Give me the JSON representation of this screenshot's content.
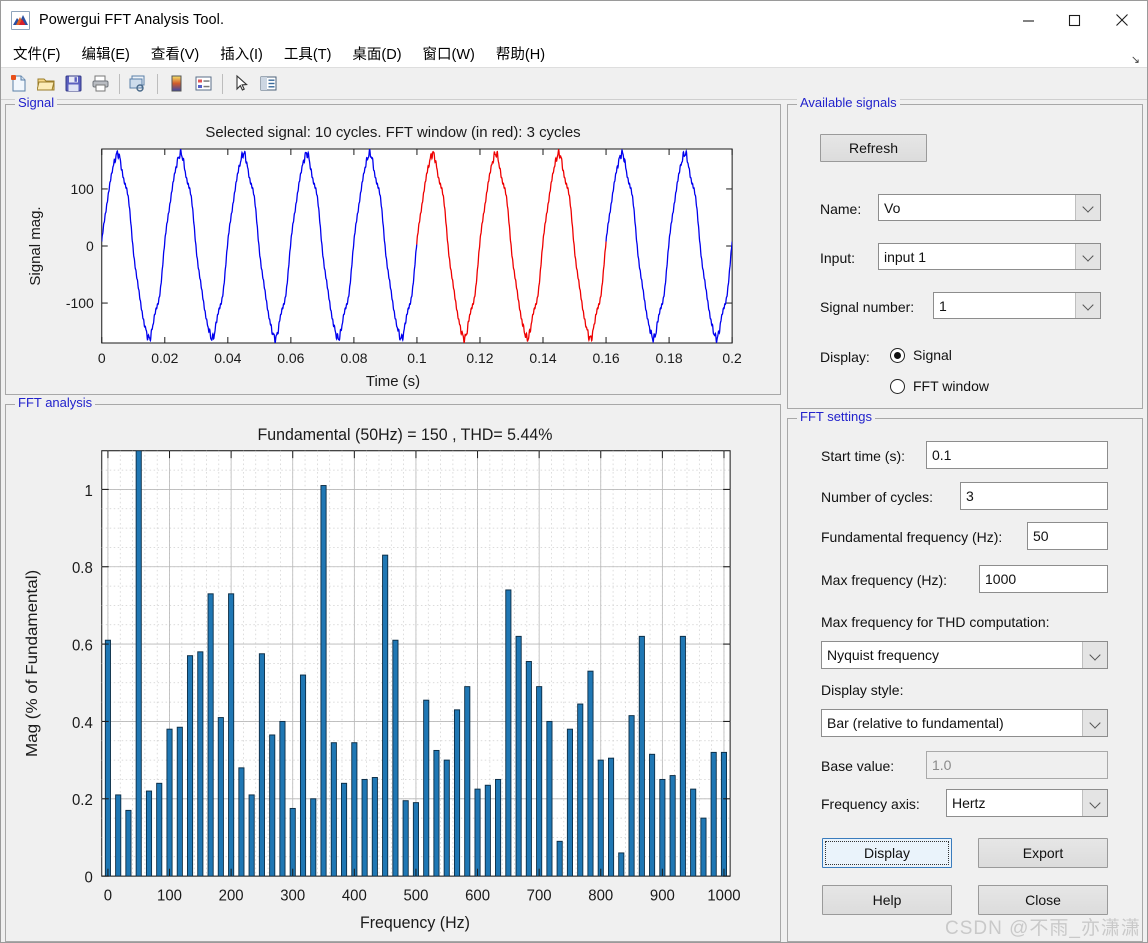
{
  "window": {
    "title": "Powergui FFT Analysis Tool.",
    "icon": "matlab-scope-icon",
    "minimize": "–",
    "maximize": "□",
    "close": "✕"
  },
  "menubar": {
    "items": [
      {
        "name": "file",
        "text": "文件(F)",
        "pre": "文件(",
        "key": "F",
        "post": ")"
      },
      {
        "name": "edit",
        "text": "编辑(E)",
        "pre": "编辑(",
        "key": "E",
        "post": ")"
      },
      {
        "name": "view",
        "text": "查看(V)",
        "pre": "查看(",
        "key": "V",
        "post": ")"
      },
      {
        "name": "insert",
        "text": "插入(I)",
        "pre": "插入(",
        "key": "I",
        "post": ")"
      },
      {
        "name": "tools",
        "text": "工具(T)",
        "pre": "工具(",
        "key": "T",
        "post": ")"
      },
      {
        "name": "desktop",
        "text": "桌面(D)",
        "pre": "桌面(",
        "key": "D",
        "post": ")"
      },
      {
        "name": "window",
        "text": "窗口(W)",
        "pre": "窗口(",
        "key": "W",
        "post": ")"
      },
      {
        "name": "help",
        "text": "帮助(H)",
        "pre": "帮助(",
        "key": "H",
        "post": ")"
      }
    ],
    "overflow": "↘"
  },
  "toolbar": {
    "buttons": [
      {
        "name": "new-figure-icon"
      },
      {
        "name": "open-file-icon"
      },
      {
        "name": "save-figure-icon"
      },
      {
        "name": "print-figure-icon"
      },
      {
        "name": "link-plot-icon"
      },
      {
        "name": "colorbar-icon"
      },
      {
        "name": "legend-icon"
      },
      {
        "name": "pointer-icon"
      },
      {
        "name": "plot-browser-icon"
      }
    ]
  },
  "signal_panel": {
    "legend": "Signal"
  },
  "fft_panel": {
    "legend": "FFT analysis"
  },
  "available_signals": {
    "legend": "Available signals",
    "refresh_label": "Refresh",
    "name_label": "Name:",
    "name_value": "Vo",
    "input_label": "Input:",
    "input_value": "input 1",
    "signal_number_label": "Signal number:",
    "signal_number_value": "1",
    "display_label": "Display:",
    "display_options": [
      {
        "label": "Signal",
        "selected": true
      },
      {
        "label": "FFT window",
        "selected": false
      }
    ]
  },
  "fft_settings": {
    "legend": "FFT settings",
    "start_time_label": "Start time (s):",
    "start_time_value": "0.1",
    "cycles_label": "Number of cycles:",
    "cycles_value": "3",
    "fundamental_label": "Fundamental frequency (Hz):",
    "fundamental_value": "50",
    "maxfreq_label": "Max frequency (Hz):",
    "maxfreq_value": "1000",
    "thd_label": "Max frequency for THD computation:",
    "thd_value": "Nyquist frequency",
    "display_style_label": "Display style:",
    "display_style_value": "Bar (relative to fundamental)",
    "base_value_label": "Base value:",
    "base_value_value": "1.0",
    "freq_axis_label": "Frequency axis:",
    "freq_axis_value": "Hertz",
    "display_button": "Display",
    "export_button": "Export",
    "help_button": "Help",
    "close_button": "Close"
  },
  "watermark": "CSDN @不雨_亦潇潇",
  "chart_data": [
    {
      "id": "signal-plot",
      "type": "line",
      "title": "Selected signal: 10 cycles. FFT window (in red): 3 cycles",
      "xlabel": "Time (s)",
      "ylabel": "Signal mag.",
      "xlim": [
        0,
        0.2
      ],
      "ylim": [
        -170,
        170
      ],
      "xticks": [
        0,
        0.02,
        0.04,
        0.06,
        0.08,
        0.1,
        0.12,
        0.14,
        0.16,
        0.18,
        0.2
      ],
      "xticklabels": [
        "0",
        "0.02",
        "0.04",
        "0.06",
        "0.08",
        "0.1",
        "0.12",
        "0.14",
        "0.16",
        "0.18",
        "0.2"
      ],
      "yticks": [
        -100,
        0,
        100
      ],
      "yticklabels": [
        "-100",
        "0",
        "100"
      ],
      "grid": false,
      "series": [
        {
          "name": "signal",
          "color": "#0000ee",
          "amplitude": 155,
          "frequency": 50,
          "cycles": 10
        },
        {
          "name": "fft-window",
          "color": "#ee0000",
          "window_start": 0.1,
          "window_end": 0.16,
          "cycles": 3
        }
      ]
    },
    {
      "id": "fft-bar-plot",
      "type": "bar",
      "title": "Fundamental (50Hz) = 150 , THD= 5.44%",
      "xlabel": "Frequency (Hz)",
      "ylabel": "Mag (% of Fundamental)",
      "xlim": [
        -10,
        1010
      ],
      "ylim": [
        0,
        1.1
      ],
      "xticks": [
        0,
        100,
        200,
        300,
        400,
        500,
        600,
        700,
        800,
        900,
        1000
      ],
      "xticklabels": [
        "0",
        "100",
        "200",
        "300",
        "400",
        "500",
        "600",
        "700",
        "800",
        "900",
        "1000"
      ],
      "yticks": [
        0,
        0.2,
        0.4,
        0.6,
        0.8,
        1
      ],
      "yticklabels": [
        "0",
        "0.2",
        "0.4",
        "0.6",
        "0.8",
        "1"
      ],
      "grid": true,
      "bar_color": "#1f77b4",
      "bar_edge": "#0c2d45",
      "fundamental_hz": 50,
      "fundamental_value": 150,
      "thd_percent": 5.44,
      "frequencies": [
        0,
        16.7,
        33.3,
        50,
        66.7,
        83.3,
        100,
        116.7,
        133.3,
        150,
        166.7,
        183.3,
        200,
        216.7,
        233.3,
        250,
        266.7,
        283.3,
        300,
        316.7,
        333.3,
        350,
        366.7,
        383.3,
        400,
        416.7,
        433.3,
        450,
        466.7,
        483.3,
        500,
        516.7,
        533.3,
        550,
        566.7,
        583.3,
        600,
        616.7,
        633.3,
        650,
        666.7,
        683.3,
        700,
        716.7,
        733.3,
        750,
        766.7,
        783.3,
        800,
        816.7,
        833.3,
        850,
        866.7,
        883.3,
        900,
        916.7,
        933.3,
        950,
        966.7,
        983.3,
        1000
      ],
      "values": [
        0.61,
        0.21,
        0.17,
        1.1,
        0.22,
        0.24,
        0.38,
        0.385,
        0.57,
        0.58,
        0.73,
        0.41,
        0.73,
        0.28,
        0.21,
        0.575,
        0.365,
        0.4,
        0.175,
        0.52,
        0.2,
        1.01,
        0.345,
        0.24,
        0.345,
        0.25,
        0.255,
        0.83,
        0.61,
        0.195,
        0.19,
        0.455,
        0.325,
        0.3,
        0.43,
        0.49,
        0.225,
        0.235,
        0.25,
        0.74,
        0.62,
        0.555,
        0.49,
        0.4,
        0.09,
        0.38,
        0.445,
        0.53,
        0.3,
        0.305,
        0.06,
        0.415,
        0.62,
        0.315,
        0.25,
        0.26,
        0.62,
        0.225,
        0.15,
        0.32,
        0.32
      ]
    }
  ]
}
